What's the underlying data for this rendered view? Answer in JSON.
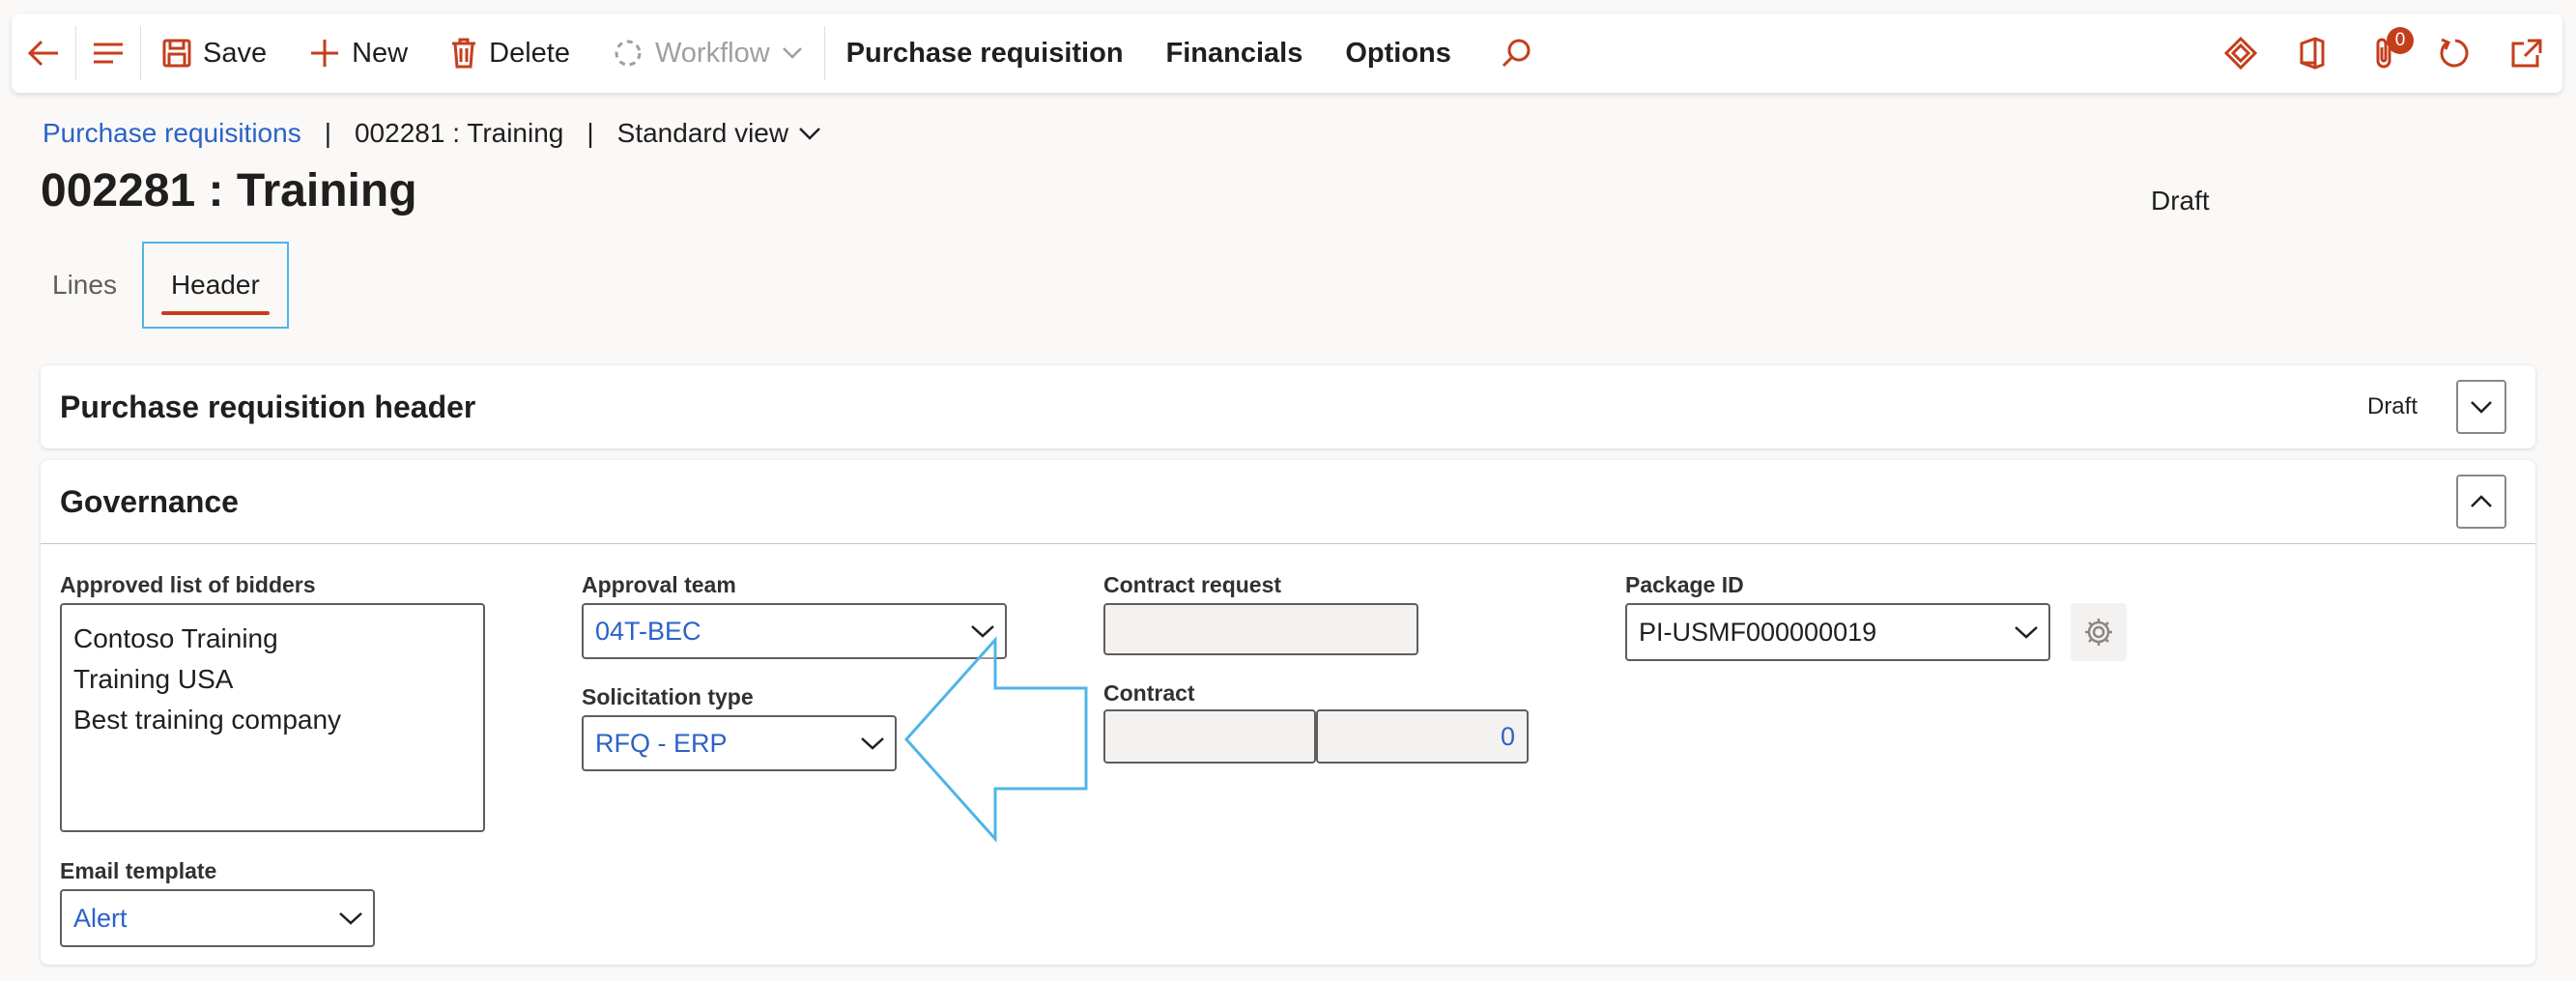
{
  "toolbar": {
    "save_label": "Save",
    "new_label": "New",
    "delete_label": "Delete",
    "workflow_label": "Workflow",
    "menus": [
      "Purchase requisition",
      "Financials",
      "Options"
    ],
    "attachments_count": "0"
  },
  "breadcrumb": {
    "list_link": "Purchase requisitions",
    "record": "002281 : Training",
    "view": "Standard view"
  },
  "page": {
    "title": "002281 : Training",
    "status": "Draft"
  },
  "tabs": [
    {
      "label": "Lines"
    },
    {
      "label": "Header"
    }
  ],
  "sections": {
    "header": {
      "title": "Purchase requisition header",
      "status": "Draft"
    },
    "governance": {
      "title": "Governance"
    }
  },
  "fields": {
    "approved_bidders": {
      "label": "Approved list of bidders",
      "values": [
        "Contoso Training",
        "Training USA",
        "Best training company"
      ]
    },
    "email_template": {
      "label": "Email template",
      "value": "Alert"
    },
    "approval_team": {
      "label": "Approval team",
      "value": "04T-BEC"
    },
    "solicitation_type": {
      "label": "Solicitation type",
      "value": "RFQ - ERP"
    },
    "contract_request": {
      "label": "Contract request",
      "value": ""
    },
    "contract": {
      "label": "Contract",
      "value_left": "",
      "value_right": "0"
    },
    "package_id": {
      "label": "Package ID",
      "value": "PI-USMF000000019"
    }
  },
  "colors": {
    "accent": "#c43e1c",
    "link": "#2b62c8",
    "highlight": "#4fb5e8"
  }
}
